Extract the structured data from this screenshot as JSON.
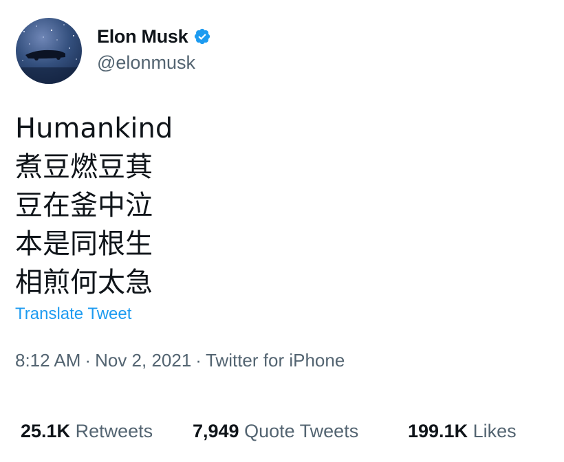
{
  "author": {
    "display_name": "Elon Musk",
    "handle": "@elonmusk",
    "verified": true,
    "verified_color": "#1d9bf0",
    "avatar_icon": "starry-sky-car-avatar"
  },
  "tweet": {
    "lines": [
      "Humankind",
      "煮豆燃豆萁",
      "豆在釜中泣",
      "本是同根生",
      "相煎何太急"
    ],
    "translate_label": "Translate Tweet"
  },
  "meta": {
    "time": "8:12 AM",
    "separator": "·",
    "date": "Nov 2, 2021",
    "source": "Twitter for iPhone"
  },
  "stats": {
    "retweets": {
      "count": "25.1K",
      "label": "Retweets"
    },
    "quote_tweets": {
      "count": "7,949",
      "label": "Quote Tweets"
    },
    "likes": {
      "count": "199.1K",
      "label": "Likes"
    }
  },
  "colors": {
    "link": "#1d9bf0",
    "secondary_text": "#536471",
    "primary_text": "#0f1419"
  }
}
